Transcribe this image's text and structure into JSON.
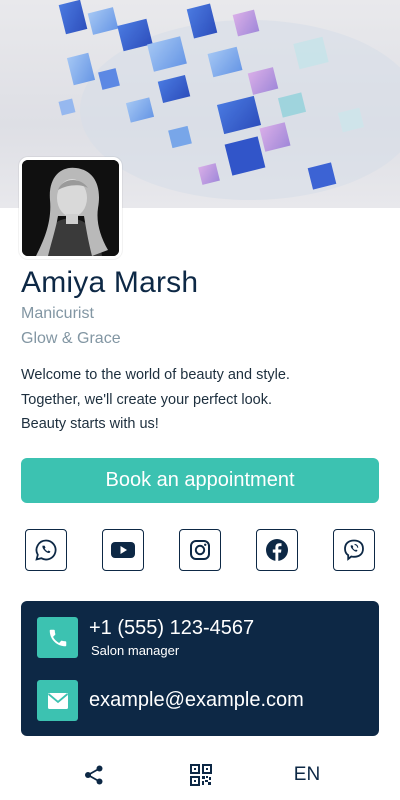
{
  "profile": {
    "name": "Amiya Marsh",
    "role": "Manicurist",
    "company": "Glow & Grace"
  },
  "bio": {
    "lines": [
      "Welcome to the world of beauty and style.",
      "Together, we'll create your perfect look.",
      "Beauty starts with us!"
    ]
  },
  "actions": {
    "book_label": "Book an appointment"
  },
  "socials": [
    {
      "icon": "whatsapp-icon"
    },
    {
      "icon": "youtube-icon"
    },
    {
      "icon": "instagram-icon"
    },
    {
      "icon": "facebook-icon"
    },
    {
      "icon": "viber-icon"
    }
  ],
  "contact": {
    "phone": "+1 (555) 123-4567",
    "phone_label": "Salon manager",
    "email": "example@example.com"
  },
  "bottom_bar": {
    "share_icon": "share-icon",
    "qr_icon": "qr-code-icon",
    "language": "EN"
  },
  "colors": {
    "accent": "#3cc2b1",
    "navy": "#0d2845",
    "muted": "#8296a3"
  }
}
